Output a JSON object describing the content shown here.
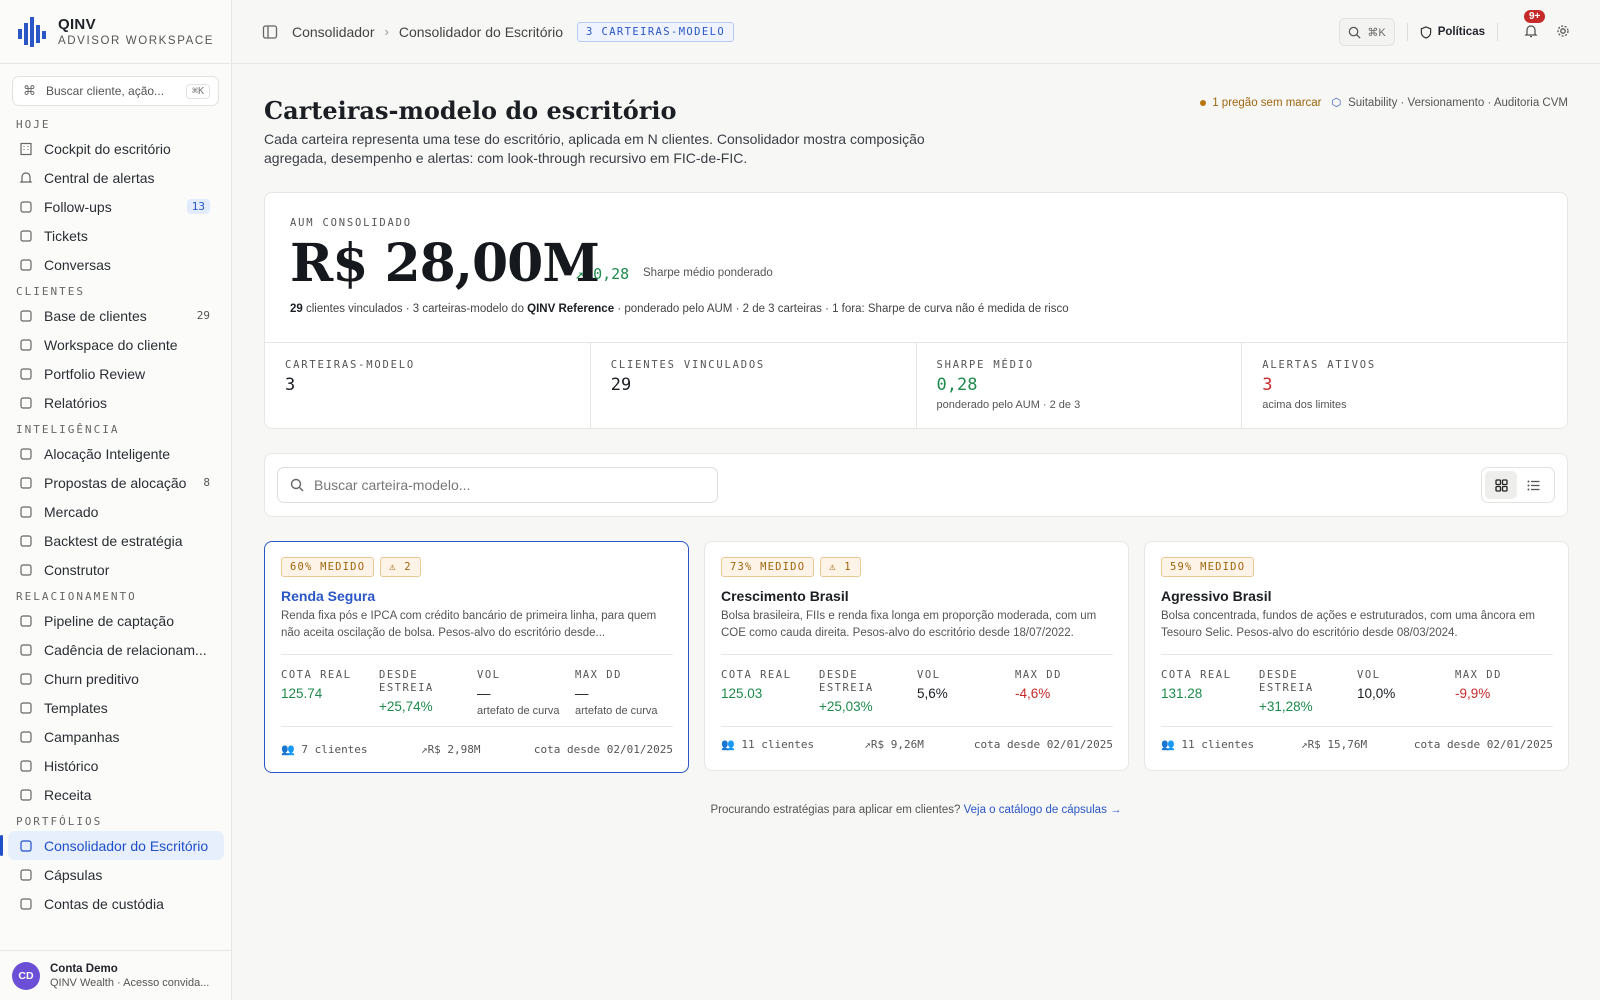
{
  "brand": {
    "name": "QINV",
    "subtitle": "ADVISOR WORKSPACE"
  },
  "sidebar": {
    "search": {
      "placeholder": "Buscar cliente, ação...",
      "shortcut": "⌘K"
    },
    "sections": [
      {
        "title": "HOJE",
        "items": [
          {
            "label": "Cockpit do escritório",
            "icon": "building-icon"
          },
          {
            "label": "Central de alertas",
            "icon": "bell-icon"
          },
          {
            "label": "Follow-ups",
            "icon": "checklist-icon",
            "count": "13",
            "badge": true
          },
          {
            "label": "Tickets",
            "icon": "ticket-icon"
          },
          {
            "label": "Conversas",
            "icon": "chat-icon"
          }
        ]
      },
      {
        "title": "CLIENTES",
        "items": [
          {
            "label": "Base de clientes",
            "icon": "users-icon",
            "count": "29"
          },
          {
            "label": "Workspace do cliente",
            "icon": "grid-icon"
          },
          {
            "label": "Portfolio Review",
            "icon": "gauge-icon"
          },
          {
            "label": "Relatórios",
            "icon": "document-icon"
          }
        ]
      },
      {
        "title": "INTELIGÊNCIA",
        "items": [
          {
            "label": "Alocação Inteligente",
            "icon": "robot-icon"
          },
          {
            "label": "Propostas de alocação",
            "icon": "trend-icon",
            "count": "8"
          },
          {
            "label": "Mercado",
            "icon": "briefcase-icon"
          },
          {
            "label": "Backtest de estratégia",
            "icon": "chart-line-icon"
          },
          {
            "label": "Construtor",
            "icon": "command-icon"
          }
        ]
      },
      {
        "title": "RELACIONAMENTO",
        "items": [
          {
            "label": "Pipeline de captação",
            "icon": "target-icon"
          },
          {
            "label": "Cadência de relacionam...",
            "icon": "workflow-icon"
          },
          {
            "label": "Churn preditivo",
            "icon": "heart-pulse-icon"
          },
          {
            "label": "Templates",
            "icon": "template-icon"
          },
          {
            "label": "Campanhas",
            "icon": "megaphone-icon"
          },
          {
            "label": "Histórico",
            "icon": "history-icon"
          },
          {
            "label": "Receita",
            "icon": "receipt-icon"
          }
        ]
      },
      {
        "title": "PORTFÓLIOS",
        "items": [
          {
            "label": "Consolidador do Escritório",
            "icon": "wallet-icon",
            "active": true
          },
          {
            "label": "Cápsulas",
            "icon": "capsule-icon"
          },
          {
            "label": "Contas de custódia",
            "icon": "bank-icon"
          }
        ]
      }
    ],
    "user": {
      "initials": "CD",
      "name": "Conta Demo",
      "sub": "QINV Wealth · Acesso convida..."
    }
  },
  "topbar": {
    "breadcrumb": [
      "Consolidador",
      "Consolidador do Escritório"
    ],
    "pill": "3 CARTEIRAS-MODELO",
    "search_shortcut": "⌘K",
    "policies": "Políticas",
    "notifications": "9+"
  },
  "header": {
    "title": "Carteiras-modelo do escritório",
    "description": "Cada carteira representa uma tese do escritório, aplicada em N clientes. Consolidador mostra composição agregada, desempenho e alertas: com look-through recursivo em FIC-de-FIC.",
    "pregao": "1 pregão sem marcar",
    "compliance": "Suitability · Versionamento · Auditoria CVM"
  },
  "aum": {
    "label": "AUM CONSOLIDADO",
    "value": "R$ 28,00M",
    "delta": "0,28",
    "delta_note": "Sharpe médio ponderado",
    "line_count": "29",
    "line_a": "clientes vinculados · 3 carteiras-modelo do",
    "line_brand": "QINV Reference",
    "line_b": "· ponderado pelo AUM · 2 de 3 carteiras · 1 fora: Sharpe de curva não é medida de risco",
    "stats": [
      {
        "label": "CARTEIRAS-MODELO",
        "value": "3",
        "sub": "",
        "tone": ""
      },
      {
        "label": "CLIENTES VINCULADOS",
        "value": "29",
        "sub": "",
        "tone": ""
      },
      {
        "label": "SHARPE MÉDIO",
        "value": "0,28",
        "sub": "ponderado pelo AUM · 2 de 3",
        "tone": "green"
      },
      {
        "label": "ALERTAS ATIVOS",
        "value": "3",
        "sub": "acima dos limites",
        "tone": "red"
      }
    ]
  },
  "toolbar": {
    "search_placeholder": "Buscar carteira-modelo..."
  },
  "cards": [
    {
      "tag": "60% MEDIDO",
      "alerts": "2",
      "title": "Renda Segura",
      "desc": "Renda fixa pós e IPCA com crédito bancário de primeira linha, para quem não aceita oscilação de bolsa. Pesos-alvo do escritório desde...",
      "metrics": [
        {
          "label": "COTA REAL",
          "value": "125.74",
          "tone": "green",
          "sub": ""
        },
        {
          "label": "DESDE ESTREIA",
          "value": "+25,74%",
          "tone": "green",
          "sub": ""
        },
        {
          "label": "VOL",
          "value": "—",
          "tone": "",
          "sub": "artefato de curva"
        },
        {
          "label": "MAX DD",
          "value": "—",
          "tone": "",
          "sub": "artefato de curva"
        }
      ],
      "clients": "7 clientes",
      "aum": "R$ 2,98M",
      "since": "cota desde 02/01/2025"
    },
    {
      "tag": "73% MEDIDO",
      "alerts": "1",
      "title": "Crescimento Brasil",
      "desc": "Bolsa brasileira, FIIs e renda fixa longa em proporção moderada, com um COE como cauda direita. Pesos-alvo do escritório desde 18/07/2022.",
      "metrics": [
        {
          "label": "COTA REAL",
          "value": "125.03",
          "tone": "green",
          "sub": ""
        },
        {
          "label": "DESDE ESTREIA",
          "value": "+25,03%",
          "tone": "green",
          "sub": ""
        },
        {
          "label": "VOL",
          "value": "5,6%",
          "tone": "",
          "sub": ""
        },
        {
          "label": "MAX DD",
          "value": "-4,6%",
          "tone": "red",
          "sub": ""
        }
      ],
      "clients": "11 clientes",
      "aum": "R$ 9,26M",
      "since": "cota desde 02/01/2025"
    },
    {
      "tag": "59% MEDIDO",
      "alerts": "",
      "title": "Agressivo Brasil",
      "desc": "Bolsa concentrada, fundos de ações e estruturados, com uma âncora em Tesouro Selic. Pesos-alvo do escritório desde 08/03/2024.",
      "metrics": [
        {
          "label": "COTA REAL",
          "value": "131.28",
          "tone": "green",
          "sub": ""
        },
        {
          "label": "DESDE ESTREIA",
          "value": "+31,28%",
          "tone": "green",
          "sub": ""
        },
        {
          "label": "VOL",
          "value": "10,0%",
          "tone": "",
          "sub": ""
        },
        {
          "label": "MAX DD",
          "value": "-9,9%",
          "tone": "red",
          "sub": ""
        }
      ],
      "clients": "11 clientes",
      "aum": "R$ 15,76M",
      "since": "cota desde 02/01/2025"
    }
  ],
  "footer": {
    "text": "Procurando estratégias para aplicar em clientes?",
    "link": "Veja o catálogo de cápsulas →"
  },
  "colors": {
    "accent": "#2a56c6",
    "positive": "#1f8a4c",
    "negative": "#c62b2b",
    "warning": "#a06610"
  }
}
